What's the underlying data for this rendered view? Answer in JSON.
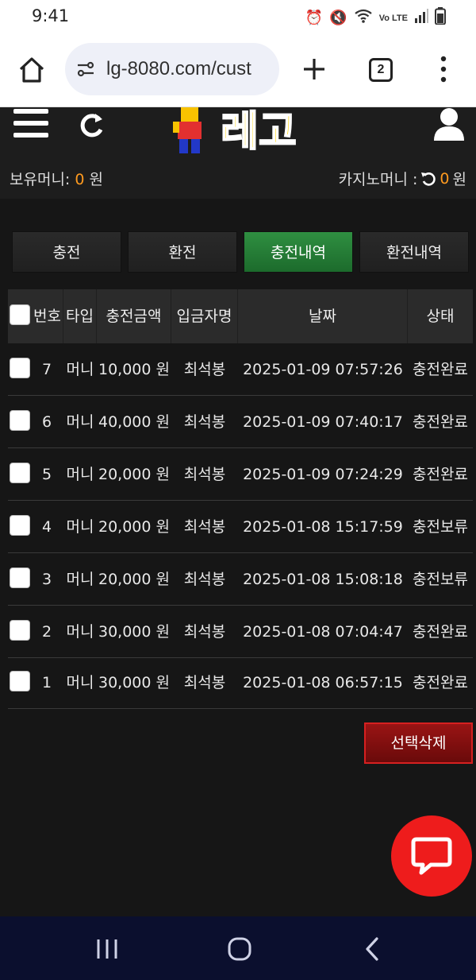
{
  "status_bar": {
    "time": "9:41",
    "icons": [
      "alarm-icon",
      "mute-icon",
      "wifi-icon",
      "volte-icon",
      "signal-icon",
      "battery-icon"
    ],
    "volte_label": "Vo LTE"
  },
  "browser": {
    "url": "lg-8080.com/cust",
    "tab_count": "2"
  },
  "header": {
    "logo_text": "레고",
    "balance_label": "보유머니:",
    "balance_value": "0",
    "balance_unit": "원",
    "casino_label": "카지노머니 :",
    "casino_value": "0",
    "casino_unit": "원"
  },
  "tabs": [
    {
      "label": "충전",
      "active": false
    },
    {
      "label": "환전",
      "active": false
    },
    {
      "label": "충전내역",
      "active": true
    },
    {
      "label": "환전내역",
      "active": false
    }
  ],
  "table": {
    "headers": [
      "번호",
      "타입",
      "충전금액",
      "입금자명",
      "날짜",
      "상태"
    ],
    "rows": [
      {
        "no": "7",
        "type": "머니",
        "amount": "10,000 원",
        "depositor": "최석봉",
        "date": "2025-01-09 07:57:26",
        "status": "충전완료"
      },
      {
        "no": "6",
        "type": "머니",
        "amount": "40,000 원",
        "depositor": "최석봉",
        "date": "2025-01-09 07:40:17",
        "status": "충전완료"
      },
      {
        "no": "5",
        "type": "머니",
        "amount": "20,000 원",
        "depositor": "최석봉",
        "date": "2025-01-09 07:24:29",
        "status": "충전완료"
      },
      {
        "no": "4",
        "type": "머니",
        "amount": "20,000 원",
        "depositor": "최석봉",
        "date": "2025-01-08 15:17:59",
        "status": "충전보류"
      },
      {
        "no": "3",
        "type": "머니",
        "amount": "20,000 원",
        "depositor": "최석봉",
        "date": "2025-01-08 15:08:18",
        "status": "충전보류"
      },
      {
        "no": "2",
        "type": "머니",
        "amount": "30,000 원",
        "depositor": "최석봉",
        "date": "2025-01-08 07:04:47",
        "status": "충전완료"
      },
      {
        "no": "1",
        "type": "머니",
        "amount": "30,000 원",
        "depositor": "최석봉",
        "date": "2025-01-08 06:57:15",
        "status": "충전완료"
      }
    ]
  },
  "delete_button": "선택삭제",
  "colors": {
    "accent_orange": "#ff9a1f",
    "tab_active": "#2f8f41",
    "delete_red": "#9a1414",
    "chat_red": "#ee1c1c"
  }
}
